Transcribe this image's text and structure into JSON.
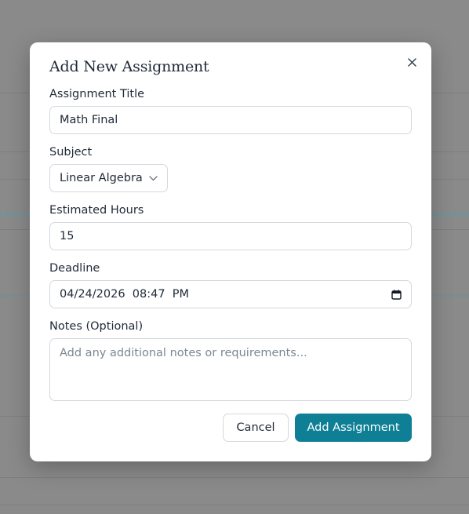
{
  "modal": {
    "title": "Add New Assignment"
  },
  "fields": {
    "title": {
      "label": "Assignment Title",
      "value": "Math Final"
    },
    "subject": {
      "label": "Subject",
      "value": "Linear Algebra"
    },
    "hours": {
      "label": "Estimated Hours",
      "value": "15"
    },
    "deadline": {
      "label": "Deadline",
      "value": "04/24/2026  08:47  PM"
    },
    "notes": {
      "label": "Notes (Optional)",
      "placeholder": "Add any additional notes or requirements..."
    }
  },
  "buttons": {
    "cancel": "Cancel",
    "submit": "Add Assignment"
  },
  "icons": {
    "close": "close-icon",
    "chevron": "chevron-down-icon",
    "calendar": "calendar-icon"
  },
  "colors": {
    "accent": "#0e7f95",
    "overlay": "#8a8a8a"
  }
}
